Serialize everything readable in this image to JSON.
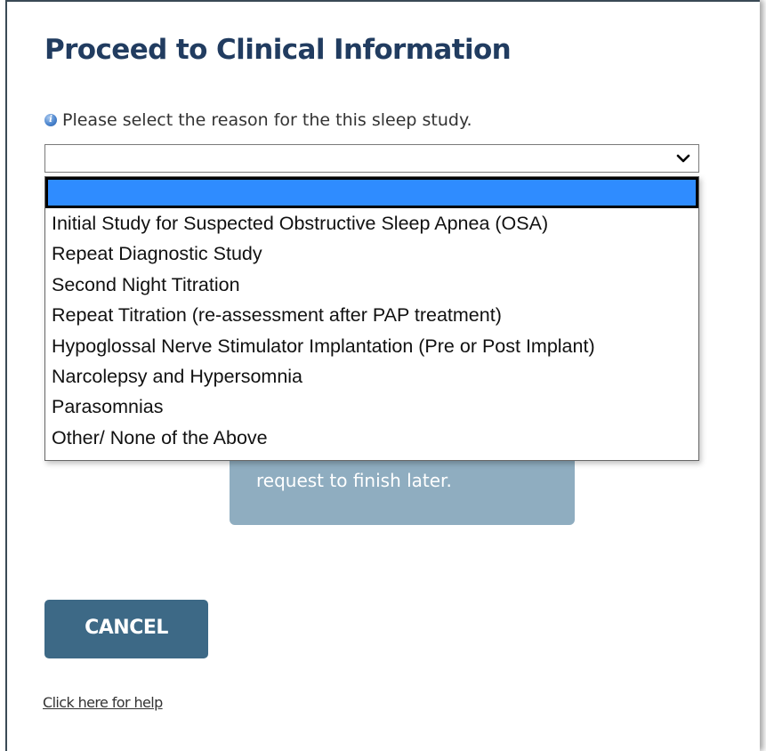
{
  "page": {
    "title": "Proceed to Clinical Information"
  },
  "reason_field": {
    "info_icon": "info-icon",
    "prompt": "Please select the reason for the this sleep study.",
    "selected_value": "",
    "dropdown_icon": "chevron-down-icon",
    "options": [
      "",
      "Initial Study for Suspected Obstructive Sleep Apnea (OSA)",
      "Repeat Diagnostic Study",
      "Second Night Titration",
      "Repeat Titration (re-assessment after PAP treatment)",
      "Hypoglossal Nerve Stimulator Implantation (Pre or Post Implant)",
      "Narcolepsy and Hypersomnia",
      "Parasomnias",
      "Other/ None of the Above"
    ],
    "highlighted_index": 0
  },
  "save_button": {
    "visible_label": "request to finish later."
  },
  "cancel_button": {
    "label": "CANCEL"
  },
  "help": {
    "link_text": "Click here for help"
  },
  "colors": {
    "title": "#213c60",
    "option_highlight": "#2f8cff",
    "save_button_bg": "#8fadc0",
    "cancel_button_bg": "#3d6986"
  }
}
